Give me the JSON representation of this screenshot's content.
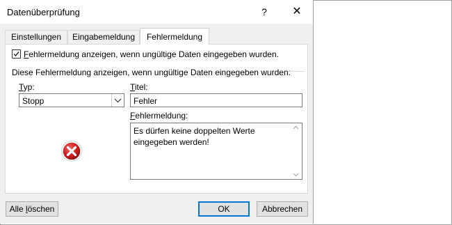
{
  "dialog": {
    "title": "Datenüberprüfung",
    "help_glyph": "?",
    "close_glyph": "✕"
  },
  "tabs": [
    {
      "label": "Einstellungen",
      "active": false
    },
    {
      "label": "Eingabemeldung",
      "active": false
    },
    {
      "label": "Fehlermeldung",
      "active": true
    }
  ],
  "checkbox": {
    "checked": true,
    "label_first": "F",
    "label_rest": "ehlermeldung anzeigen, wenn ungültige Daten eingegeben wurden."
  },
  "section_label": "Diese Fehlermeldung anzeigen, wenn ungültige Daten eingegeben wurden:",
  "type_field": {
    "label_first": "T",
    "label_rest": "yp:",
    "value": "Stopp"
  },
  "title_field": {
    "label_first": "T",
    "label_rest": "itel:",
    "value": "Fehler"
  },
  "message_field": {
    "label_first": "F",
    "label_rest": "ehlermeldung:",
    "value": "Es dürfen keine doppelten Werte eingegeben werden!"
  },
  "icon": {
    "name": "error-stop-icon",
    "color": "#d11f1f"
  },
  "buttons": {
    "clear_all_prefix": "Alle ",
    "clear_all_underlined": "l",
    "clear_all_rest": "öschen",
    "ok": "OK",
    "cancel": "Abbrechen"
  },
  "colors": {
    "dialog_bg": "#f0f0f0",
    "default_button_border": "#0078d7"
  }
}
